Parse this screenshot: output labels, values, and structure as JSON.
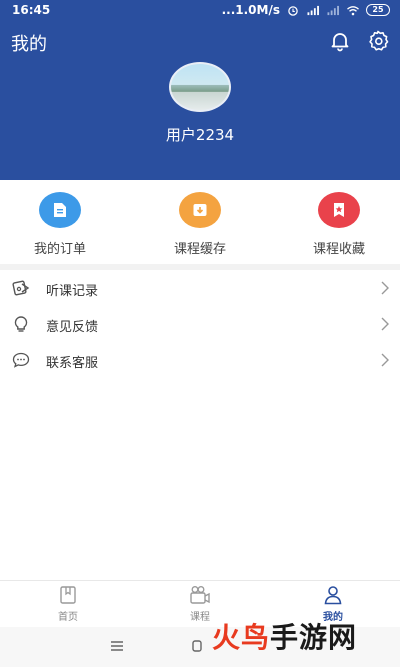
{
  "status_bar": {
    "time": "16:45",
    "speed": "...1.0M/s",
    "battery": "25"
  },
  "header": {
    "title": "我的",
    "username": "用户2234"
  },
  "quick_actions": [
    {
      "label": "我的订单",
      "icon": "order-icon",
      "color": "#3d9ae8"
    },
    {
      "label": "课程缓存",
      "icon": "download-icon",
      "color": "#f4a340"
    },
    {
      "label": "课程收藏",
      "icon": "bookmark-star-icon",
      "color": "#e9424b"
    }
  ],
  "menu": [
    {
      "label": "听课记录",
      "icon": "history-icon"
    },
    {
      "label": "意见反馈",
      "icon": "lightbulb-icon"
    },
    {
      "label": "联系客服",
      "icon": "chat-icon"
    }
  ],
  "tabbar": [
    {
      "label": "首页",
      "icon": "home-book-icon",
      "active": false
    },
    {
      "label": "课程",
      "icon": "camera-icon",
      "active": false
    },
    {
      "label": "我的",
      "icon": "person-icon",
      "active": true
    }
  ],
  "watermark": {
    "part1": "火鸟",
    "part2": "手游网"
  },
  "colors": {
    "header": "#2a4f9f",
    "accent": "#2a4f9f"
  }
}
